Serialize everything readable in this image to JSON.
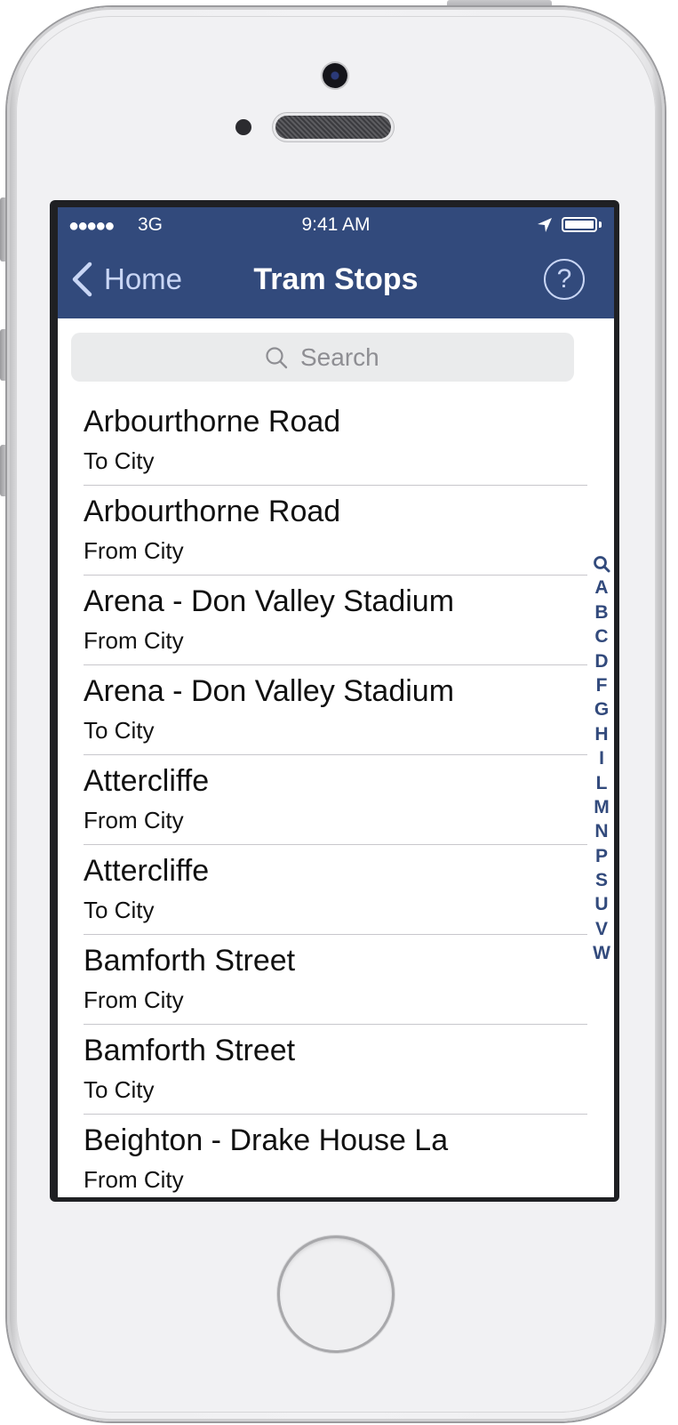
{
  "status_bar": {
    "signal": "●●●●●",
    "carrier": "3G",
    "time": "9:41 AM"
  },
  "nav": {
    "back_label": "Home",
    "title": "Tram Stops",
    "help_label": "?"
  },
  "search": {
    "placeholder": "Search"
  },
  "stops": [
    {
      "name": "Arbourthorne Road",
      "direction": "To City"
    },
    {
      "name": "Arbourthorne Road",
      "direction": "From City"
    },
    {
      "name": "Arena - Don Valley Stadium",
      "direction": "From City"
    },
    {
      "name": "Arena - Don Valley Stadium",
      "direction": "To City"
    },
    {
      "name": "Attercliffe",
      "direction": "From City"
    },
    {
      "name": "Attercliffe",
      "direction": "To City"
    },
    {
      "name": "Bamforth Street",
      "direction": "From City"
    },
    {
      "name": "Bamforth Street",
      "direction": "To City"
    },
    {
      "name": "Beighton - Drake House La",
      "direction": "From City"
    }
  ],
  "section_index": [
    "A",
    "B",
    "C",
    "D",
    "F",
    "G",
    "H",
    "I",
    "L",
    "M",
    "N",
    "P",
    "S",
    "U",
    "V",
    "W"
  ],
  "colors": {
    "nav_bar": "#324a7c",
    "nav_tint": "#c9d6f5",
    "index_tint": "#324a7c"
  }
}
